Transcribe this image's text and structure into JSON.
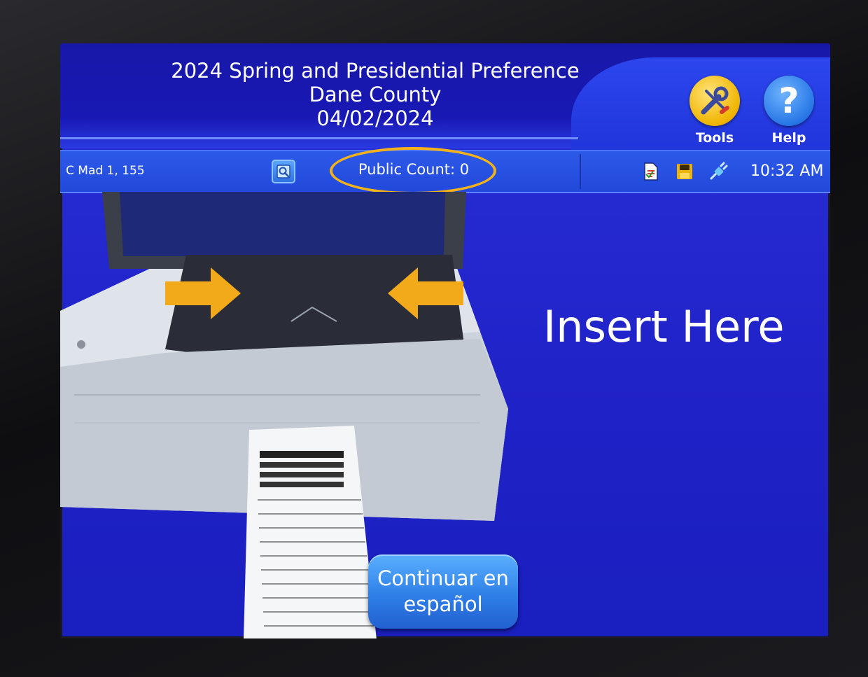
{
  "header": {
    "title_line1": "2024 Spring and Presidential Preference",
    "title_line2": "Dane County",
    "title_line3": "04/02/2024",
    "tools_label": "Tools",
    "help_label": "Help",
    "help_glyph": "?"
  },
  "status": {
    "location": "C Mad 1, 155",
    "public_count": "Public Count: 0",
    "time": "10:32 AM",
    "icons": [
      "document-icon",
      "save-icon",
      "power-plug-icon"
    ]
  },
  "main": {
    "instruction": "Insert Here",
    "language_button_line1": "Continuar en",
    "language_button_line2": "español"
  },
  "colors": {
    "screen_bg": "#2023c8",
    "header_bg": "#1818b4",
    "status_bar": "#2149db",
    "highlight_ring": "#f3b21a",
    "tools_circle": "#f0b400",
    "help_circle": "#2777e6",
    "arrow": "#f2a91a"
  }
}
